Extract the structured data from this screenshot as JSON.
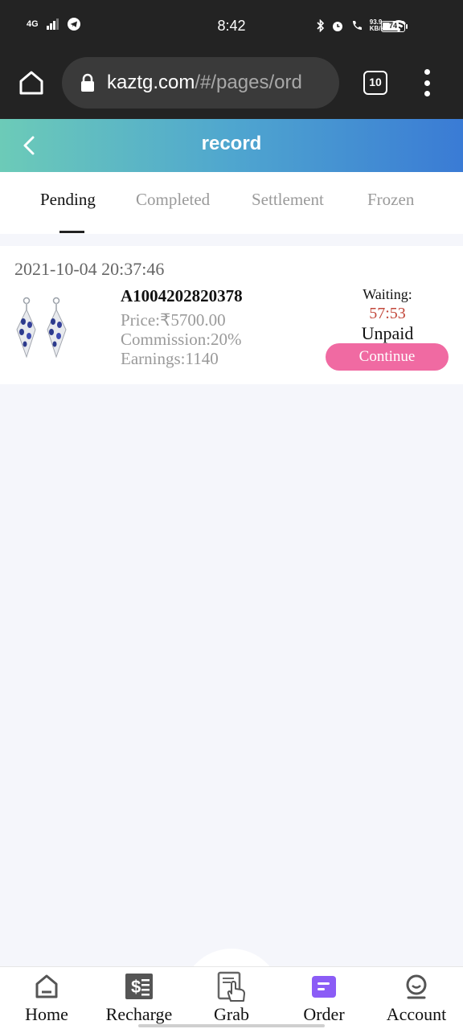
{
  "status_bar": {
    "network": "4G",
    "time": "8:42",
    "data_speed": "93.9\nKB/s",
    "battery": "74"
  },
  "browser": {
    "url_domain": "kaztg.com",
    "url_path": "/#/pages/ord",
    "tab_count": "10"
  },
  "header": {
    "title": "record"
  },
  "tabs": [
    {
      "label": "Pending",
      "active": true
    },
    {
      "label": "Completed",
      "active": false
    },
    {
      "label": "Settlement",
      "active": false
    },
    {
      "label": "Frozen",
      "active": false
    }
  ],
  "order": {
    "time": "2021-10-04 20:37:46",
    "id": "A1004202820378",
    "price": "Price:₹5700.00",
    "commission": "Commission:20%",
    "earnings": "Earnings:1140",
    "waiting_label": "Waiting:",
    "countdown": "57:53",
    "status": "Unpaid",
    "continue_label": "Continue"
  },
  "bottom_nav": [
    {
      "label": "Home",
      "icon": "home-icon"
    },
    {
      "label": "Recharge",
      "icon": "recharge-icon"
    },
    {
      "label": "Grab",
      "icon": "grab-icon"
    },
    {
      "label": "Order",
      "icon": "order-icon"
    },
    {
      "label": "Account",
      "icon": "account-icon"
    }
  ],
  "colors": {
    "accent_pink": "#f06aa2",
    "header_gradient_start": "#6ccbb8",
    "header_gradient_end": "#3a7bd5",
    "countdown_red": "#c2473a",
    "order_icon_purple": "#8b5cf6"
  }
}
